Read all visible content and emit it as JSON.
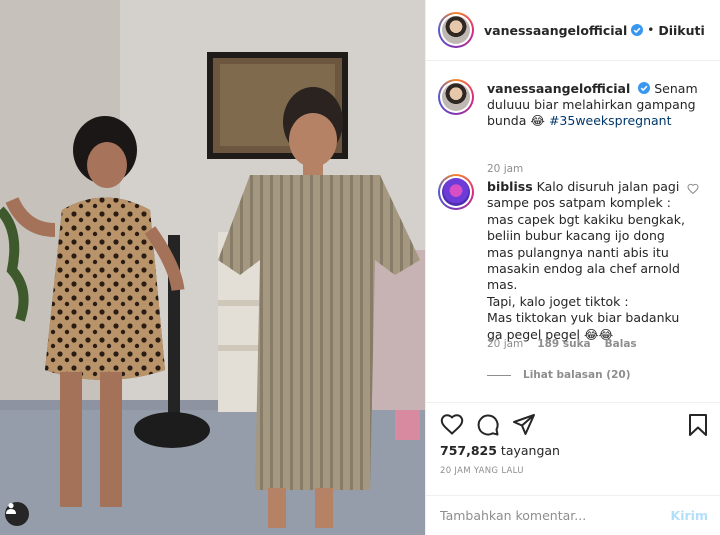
{
  "post": {
    "username": "vanessaangelofficial",
    "follow_separator": "•",
    "follow_label": "Diikuti",
    "caption_text": "Senam duluuu biar melahirkan gampang bunda 😂",
    "caption_hashtag": "#35weekspregnant",
    "caption_time": "20 jam"
  },
  "comment": {
    "username": "bibliss",
    "text": "Kalo disuruh jalan pagi sampe pos satpam komplek : mas capek bgt kakiku bengkak, beliin bubur kacang ijo dong mas pulangnya nanti abis itu masakin endog ala chef arnold mas.\nTapi, kalo joget tiktok :\nMas tiktokan yuk biar badanku ga pegel pegel 😂😂",
    "time": "20 jam",
    "likes": "189 suka",
    "reply_label": "Balas",
    "view_replies": "Lihat balasan (20)"
  },
  "stats": {
    "views_count": "757,825",
    "views_label": "tayangan",
    "time_ago": "20 JAM YANG LALU"
  },
  "composer": {
    "placeholder": "Tambahkan komentar...",
    "post_label": "Kirim"
  },
  "icons": [
    "user-tag-icon",
    "verified-icon",
    "heart-icon",
    "comment-icon",
    "share-icon",
    "bookmark-icon",
    "small-heart-icon"
  ],
  "colors": {
    "link_blue": "#00376b",
    "verified_blue": "#3897f0",
    "muted_text": "#8e8e8e",
    "post_button_disabled": "#b2dffc"
  }
}
